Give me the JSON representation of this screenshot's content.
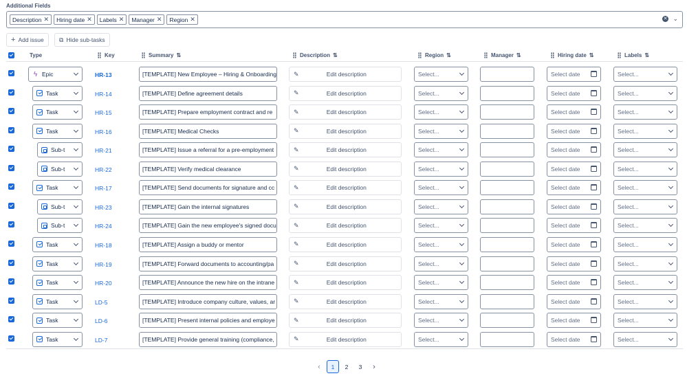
{
  "additional_fields": {
    "title": "Additional Fields",
    "chips": [
      "Description",
      "Hiring date",
      "Labels",
      "Manager",
      "Region"
    ]
  },
  "toolbar": {
    "add_issue": "Add issue",
    "hide_subtasks": "Hide sub-tasks"
  },
  "columns": {
    "type": "Type",
    "key": "Key",
    "summary": "Summary",
    "description": "Description",
    "region": "Region",
    "manager": "Manager",
    "hiring_date": "Hiring date",
    "labels": "Labels"
  },
  "placeholders": {
    "edit_description": "Edit description",
    "select": "Select...",
    "select_date": "Select date"
  },
  "rows": [
    {
      "type": "Epic",
      "icon": "epic-icon",
      "key": "HR-13",
      "summary": "[TEMPLATE] New Employee – Hiring & Onboarding"
    },
    {
      "type": "Task",
      "icon": "task-icon",
      "key": "HR-14",
      "summary": "[TEMPLATE] Define agreement details"
    },
    {
      "type": "Task",
      "icon": "task-icon",
      "key": "HR-15",
      "summary": "[TEMPLATE] Prepare employment contract and re"
    },
    {
      "type": "Task",
      "icon": "task-icon",
      "key": "HR-16",
      "summary": "[TEMPLATE] Medical Checks"
    },
    {
      "type": "Sub-t",
      "icon": "subtask-icon",
      "key": "HR-21",
      "summary": "[TEMPLATE] Issue a referral for a pre-employment"
    },
    {
      "type": "Sub-t",
      "icon": "subtask-icon",
      "key": "HR-22",
      "summary": "[TEMPLATE] Verify medical clearance"
    },
    {
      "type": "Task",
      "icon": "task-icon",
      "key": "HR-17",
      "summary": "[TEMPLATE] Send documents for signature and cc"
    },
    {
      "type": "Sub-t",
      "icon": "subtask-icon",
      "key": "HR-23",
      "summary": "[TEMPLATE] Gain the internal signatures"
    },
    {
      "type": "Sub-t",
      "icon": "subtask-icon",
      "key": "HR-24",
      "summary": "[TEMPLATE] Gain the new employee's signed docu"
    },
    {
      "type": "Task",
      "icon": "task-icon",
      "key": "HR-18",
      "summary": "[TEMPLATE] Assign a buddy or mentor"
    },
    {
      "type": "Task",
      "icon": "task-icon",
      "key": "HR-19",
      "summary": "[TEMPLATE] Forward documents to accounting/pa"
    },
    {
      "type": "Task",
      "icon": "task-icon",
      "key": "HR-20",
      "summary": "[TEMPLATE] Announce the new hire on the intrane"
    },
    {
      "type": "Task",
      "icon": "task-icon",
      "key": "LD-5",
      "summary": "[TEMPLATE] Introduce company culture, values, ar"
    },
    {
      "type": "Task",
      "icon": "task-icon",
      "key": "LD-6",
      "summary": "[TEMPLATE] Present internal policies and employe"
    },
    {
      "type": "Task",
      "icon": "task-icon",
      "key": "LD-7",
      "summary": "[TEMPLATE] Provide general training (compliance,"
    }
  ],
  "pagination": {
    "pages": [
      "1",
      "2",
      "3"
    ],
    "current": "1"
  }
}
